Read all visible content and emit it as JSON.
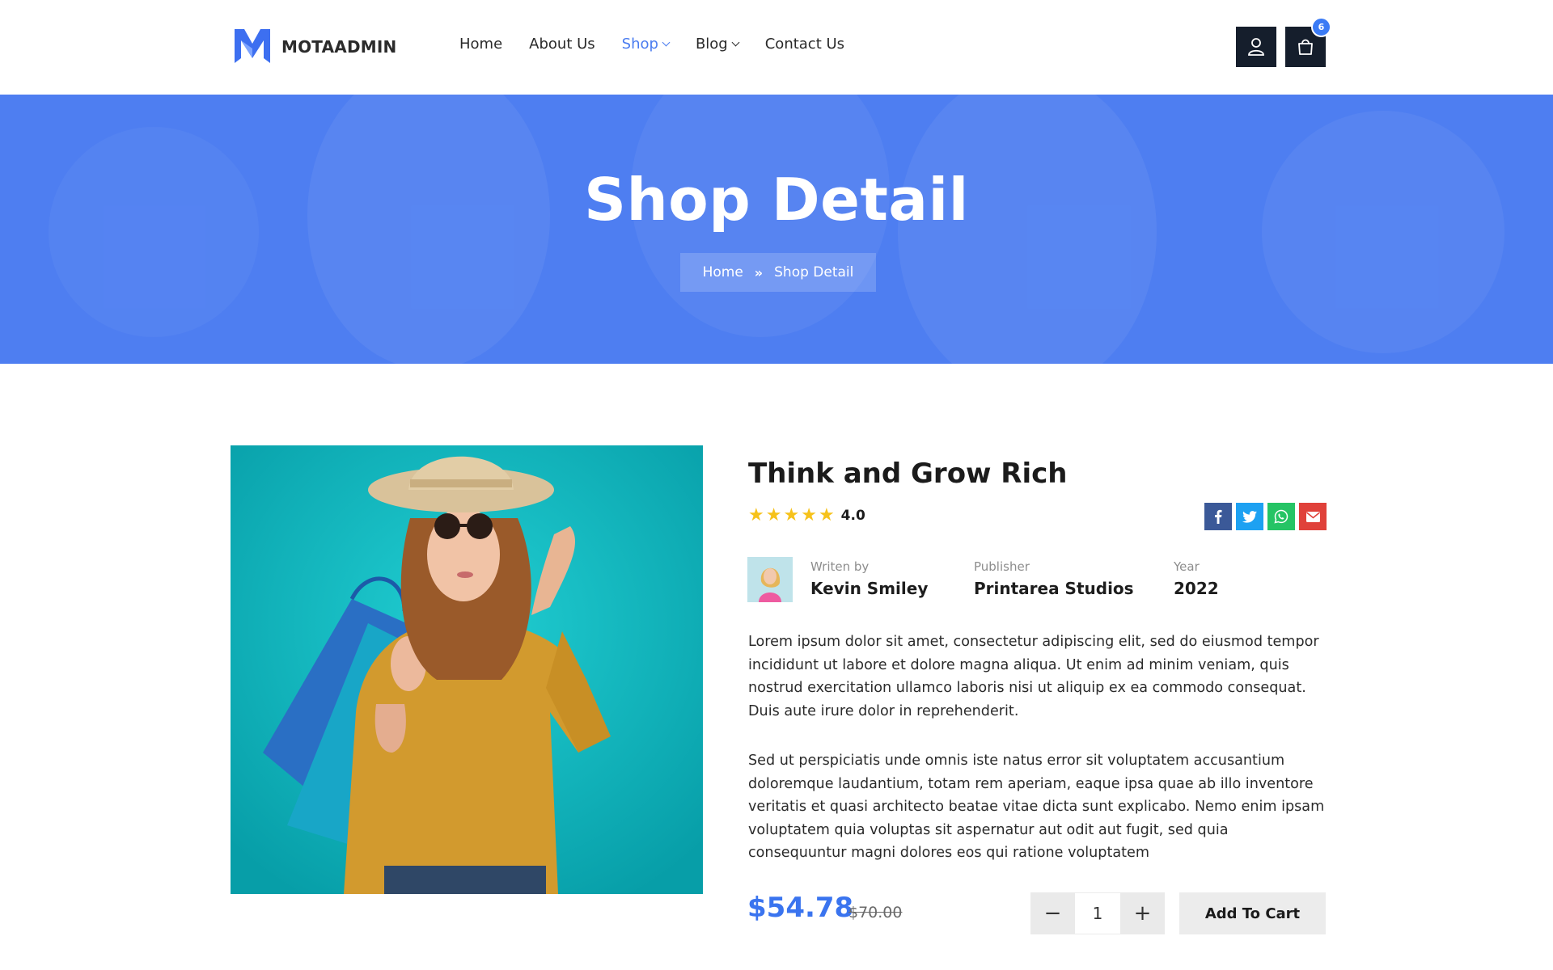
{
  "brand": {
    "name": "MOTAADMIN",
    "accent": "#4a7cf0",
    "dark": "#151e2c"
  },
  "nav": {
    "items": [
      {
        "label": "Home"
      },
      {
        "label": "About Us"
      },
      {
        "label": "Shop",
        "active": true,
        "dropdown": true
      },
      {
        "label": "Blog",
        "dropdown": true
      },
      {
        "label": "Contact Us"
      }
    ]
  },
  "header": {
    "user_icon": "user-icon",
    "cart_icon": "shopping-bag-icon",
    "cart_count": "6"
  },
  "hero": {
    "title": "Shop Detail",
    "breadcrumb": {
      "home": "Home",
      "current": "Shop Detail",
      "separator_icon": "double-chevron-right-icon"
    },
    "overlay_color": "#4e7ef1"
  },
  "product": {
    "title": "Think and Grow Rich",
    "rating": "4.0",
    "stars": 5,
    "share_icons": [
      "facebook-icon",
      "twitter-icon",
      "whatsapp-icon",
      "email-icon"
    ],
    "author": {
      "label": "Writen by",
      "value": "Kevin Smiley"
    },
    "publisher": {
      "label": "Publisher",
      "value": "Printarea Studios"
    },
    "year": {
      "label": "Year",
      "value": "2022"
    },
    "description": [
      "Lorem ipsum dolor sit amet, consectetur adipiscing elit, sed do eiusmod tempor incididunt ut labore et dolore magna aliqua. Ut enim ad minim veniam, quis nostrud exercitation ullamco laboris nisi ut aliquip ex ea commodo consequat. Duis aute irure dolor in reprehenderit.",
      "Sed ut perspiciatis unde omnis iste natus error sit voluptatem accusantium doloremque laudantium, totam rem aperiam, eaque ipsa quae ab illo inventore veritatis et quasi architecto beatae vitae dicta sunt explicabo. Nemo enim ipsam voluptatem quia voluptas sit aspernatur aut odit aut fugit, sed quia consequuntur magni dolores eos qui ratione voluptatem"
    ],
    "price": "$54.78",
    "old_price": "$70.00",
    "quantity": "1",
    "add_to_cart": "Add To Cart",
    "price_color": "#3a74ef"
  }
}
